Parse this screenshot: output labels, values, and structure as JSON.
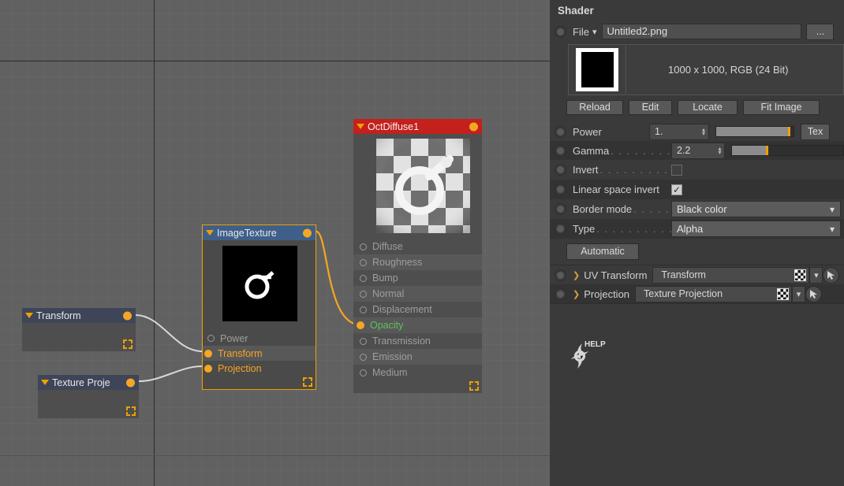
{
  "app": {
    "canvas_name": "node-graph"
  },
  "nodegraph": {
    "nodes": [
      {
        "title": "Transform",
        "type": "transform",
        "selected": false,
        "ports": []
      },
      {
        "title": "Texture Proje",
        "type": "texture-projection",
        "selected": false,
        "ports": []
      },
      {
        "title": "ImageTexture",
        "type": "image-texture",
        "selected": true,
        "ports": [
          {
            "label": "Power",
            "connected": false,
            "state": "off"
          },
          {
            "label": "Transform",
            "connected": true,
            "state": "on"
          },
          {
            "label": "Projection",
            "connected": true,
            "state": "on"
          }
        ]
      },
      {
        "title": "OctDiffuse1",
        "type": "diffuse-material",
        "selected": false,
        "ports": [
          {
            "label": "Diffuse",
            "connected": false,
            "state": "off"
          },
          {
            "label": "Roughness",
            "connected": false,
            "state": "off"
          },
          {
            "label": "Bump",
            "connected": false,
            "state": "off"
          },
          {
            "label": "Normal",
            "connected": false,
            "state": "off"
          },
          {
            "label": "Displacement",
            "connected": false,
            "state": "off"
          },
          {
            "label": "Opacity",
            "connected": true,
            "state": "green"
          },
          {
            "label": "Transmission",
            "connected": false,
            "state": "off"
          },
          {
            "label": "Emission",
            "connected": false,
            "state": "off"
          },
          {
            "label": "Medium",
            "connected": false,
            "state": "off"
          }
        ]
      }
    ],
    "colors": {
      "header_image_texture": "#3e5f8a",
      "header_diffuse": "#c4201c",
      "header_transform": "#3e4558",
      "port_connected": "#f5a623",
      "wire_data": "#d8d8d8",
      "wire_texture": "#f5a623",
      "node_selection": "#f0a000"
    }
  },
  "panel": {
    "title": "Shader",
    "file_row": {
      "label": "File",
      "value": "Untitled2.png",
      "browse_label": "..."
    },
    "image_info": "1000 x 1000, RGB (24 Bit)",
    "image_buttons": [
      "Reload",
      "Edit",
      "Locate",
      "Fit Image"
    ],
    "properties": [
      {
        "label": "Power",
        "dots": "",
        "kind": "number",
        "value": "1.",
        "slider_pct": 96,
        "extra_button": "Tex"
      },
      {
        "label": "Gamma",
        "dots": ". . . . . . . . . . .",
        "kind": "number",
        "value": "2.2",
        "slider_pct": 30
      },
      {
        "label": "Invert",
        "dots": ". . . . . . . . . . .",
        "kind": "checkbox",
        "checked": false
      },
      {
        "label": "Linear space invert",
        "dots": "",
        "kind": "checkbox",
        "checked": true
      },
      {
        "label": "Border mode",
        "dots": ". . . . .",
        "kind": "combo",
        "value": "Black color"
      },
      {
        "label": "Type",
        "dots": ". . . . . . . . . . .",
        "kind": "combo",
        "value": "Alpha"
      }
    ],
    "automatic_button": "Automatic",
    "link_rows": [
      {
        "label": "UV Transform",
        "value": "Transform"
      },
      {
        "label": "Projection",
        "value": "Texture Projection"
      }
    ],
    "help_label": "HELP"
  }
}
